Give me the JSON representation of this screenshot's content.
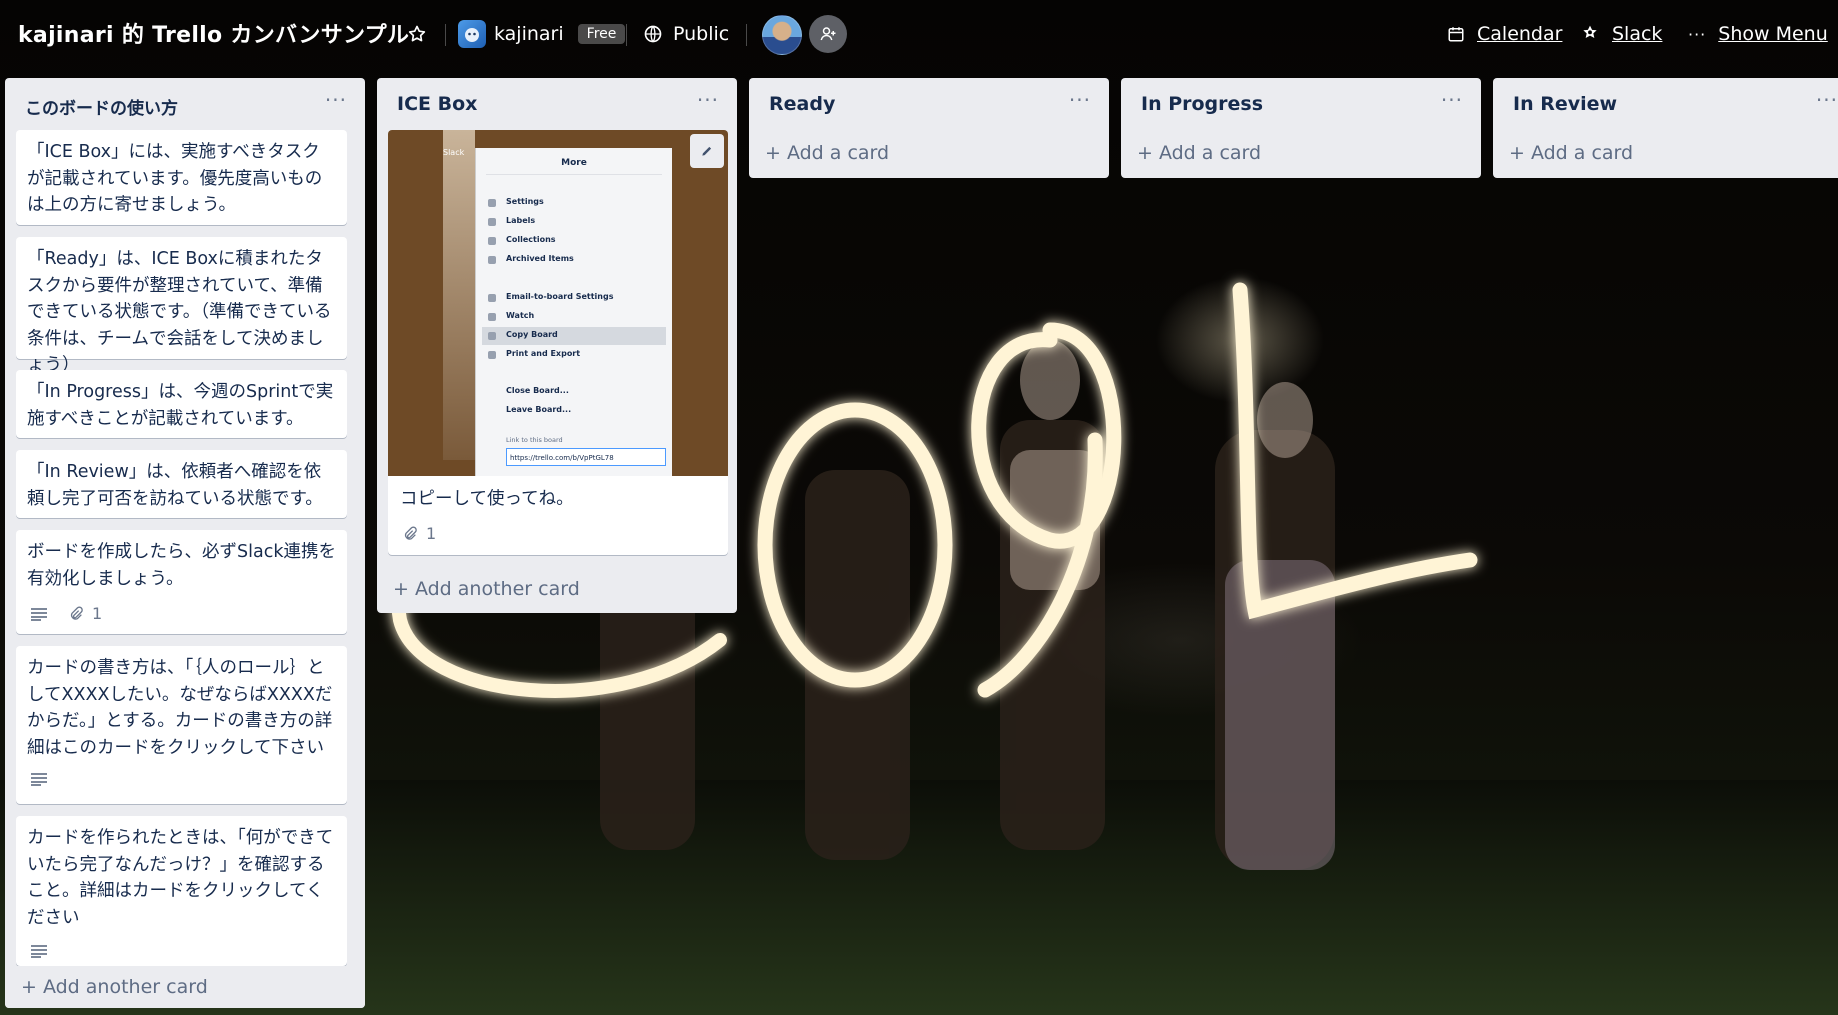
{
  "board": {
    "title": "kajinari 的 Trello カンバンサンプル",
    "workspace": "kajinari",
    "plan_badge": "Free",
    "visibility": "Public"
  },
  "header_actions": {
    "calendar": "Calendar",
    "slack": "Slack",
    "show_menu": "Show Menu"
  },
  "icons": [
    "star-icon",
    "globe-icon",
    "add-member-icon",
    "calendar-icon",
    "slack-icon",
    "more-icon",
    "description-icon",
    "attachment-icon",
    "pencil-icon",
    "plus-icon"
  ],
  "lists": [
    {
      "title": "このボードの使い方",
      "menu": "···",
      "cards": [
        {
          "text": "「ICE Box」には、実施すべきタスクが記載されています。優先度高いものは上の方に寄せましょう。"
        },
        {
          "text": "「Ready」は、ICE Boxに積まれたタスクから要件が整理されていて、準備できている状態です。（準備できている条件は、チームで会話をして決めましょう）"
        },
        {
          "text": "「In Progress」は、今週のSprintで実施すべきことが記載されています。"
        },
        {
          "text": "「In Review」は、依頼者へ確認を依頼し完了可否を訪ねている状態です。"
        },
        {
          "text": "ボードを作成したら、必ずSlack連携を有効化しましょう。",
          "attachments": "1"
        },
        {
          "text": "カードの書き方は、「｛人のロール｝としてXXXXしたい。なぜならばXXXXだからだ。」とする。カードの書き方の詳細はこのカードをクリックして下さい"
        },
        {
          "text": "カードを作られたときは、「何ができていたら完了なんだっけ？」を確認すること。詳細はカードをクリックしてください"
        }
      ],
      "add": "+ Add another card"
    },
    {
      "title": "ICE Box",
      "menu": "···",
      "cards": [
        {
          "text": "コピーして使ってね。",
          "attachments": "1",
          "cover": {
            "sidebar_label": "Slack",
            "panel_title": "More",
            "menu_items": [
              "Settings",
              "Labels",
              "Collections",
              "Archived Items",
              "Email-to-board Settings",
              "Watch",
              "Copy Board",
              "Print and Export",
              "Close Board...",
              "Leave Board..."
            ],
            "link_label": "Link to this board",
            "link_url": "https://trello.com/b/VpPtGL78"
          }
        }
      ],
      "add": "+ Add another card"
    },
    {
      "title": "Ready",
      "menu": "···",
      "add": "+ Add a card"
    },
    {
      "title": "In Progress",
      "menu": "···",
      "add": "+ Add a card"
    },
    {
      "title": "In Review",
      "menu": "···",
      "add": "+ Add a card"
    }
  ]
}
